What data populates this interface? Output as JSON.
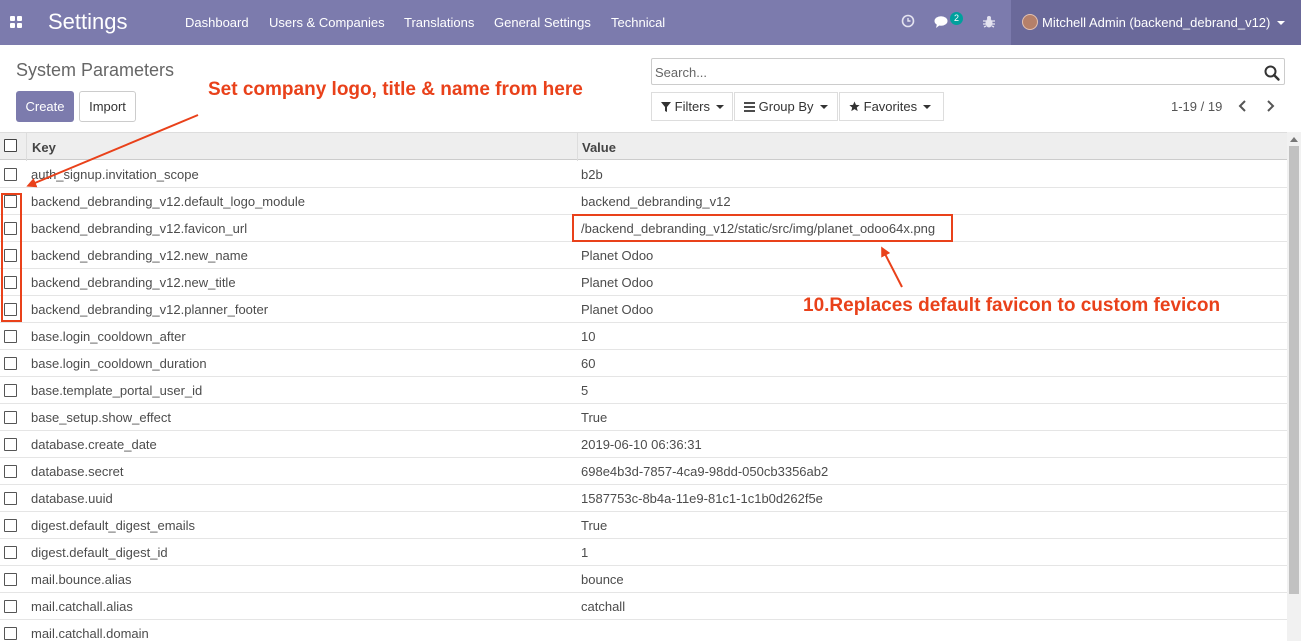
{
  "navbar": {
    "app_title": "Settings",
    "menu": [
      "Dashboard",
      "Users & Companies",
      "Translations",
      "General Settings",
      "Technical"
    ],
    "messages_badge": "2",
    "user_name": "Mitchell Admin (backend_debrand_v12)"
  },
  "control_panel": {
    "breadcrumb": "System Parameters",
    "create_label": "Create",
    "import_label": "Import",
    "search_placeholder": "Search...",
    "filters_label": "Filters",
    "groupby_label": "Group By",
    "favorites_label": "Favorites",
    "pager": "1-19 / 19"
  },
  "table": {
    "headers": {
      "key": "Key",
      "value": "Value"
    },
    "rows": [
      {
        "key": "auth_signup.invitation_scope",
        "value": "b2b"
      },
      {
        "key": "backend_debranding_v12.default_logo_module",
        "value": "backend_debranding_v12"
      },
      {
        "key": "backend_debranding_v12.favicon_url",
        "value": "/backend_debranding_v12/static/src/img/planet_odoo64x.png"
      },
      {
        "key": "backend_debranding_v12.new_name",
        "value": "Planet Odoo"
      },
      {
        "key": "backend_debranding_v12.new_title",
        "value": "Planet Odoo"
      },
      {
        "key": "backend_debranding_v12.planner_footer",
        "value": "Planet Odoo"
      },
      {
        "key": "base.login_cooldown_after",
        "value": "10"
      },
      {
        "key": "base.login_cooldown_duration",
        "value": "60"
      },
      {
        "key": "base.template_portal_user_id",
        "value": "5"
      },
      {
        "key": "base_setup.show_effect",
        "value": "True"
      },
      {
        "key": "database.create_date",
        "value": "2019-06-10 06:36:31"
      },
      {
        "key": "database.secret",
        "value": "698e4b3d-7857-4ca9-98dd-050cb3356ab2"
      },
      {
        "key": "database.uuid",
        "value": "1587753c-8b4a-11e9-81c1-1c1b0d262f5e"
      },
      {
        "key": "digest.default_digest_emails",
        "value": "True"
      },
      {
        "key": "digest.default_digest_id",
        "value": "1"
      },
      {
        "key": "mail.bounce.alias",
        "value": "bounce"
      },
      {
        "key": "mail.catchall.alias",
        "value": "catchall"
      },
      {
        "key": "mail.catchall.domain",
        "value": ""
      }
    ]
  },
  "annotations": {
    "top_note": "Set company logo, title & name from here",
    "favicon_note": "10.Replaces default favicon to custom fevicon",
    "color": "#e9411a"
  },
  "colors": {
    "brand": "#7c7bad",
    "user_menu": "#6a699a",
    "badge": "#00a09d"
  }
}
